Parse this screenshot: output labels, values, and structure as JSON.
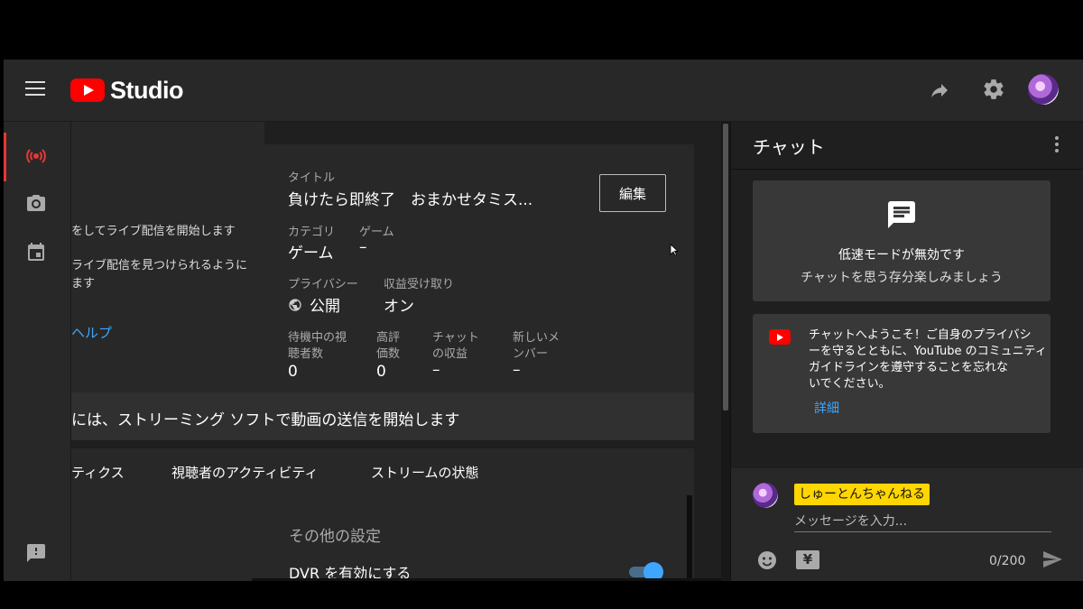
{
  "header": {
    "menu_icon": "hamburger-icon",
    "logo_text": "Studio",
    "share_icon": "share-arrow-icon",
    "settings_icon": "gear-icon"
  },
  "rail": {
    "items": [
      {
        "icon": "live-broadcast-icon",
        "active": true
      },
      {
        "icon": "camera-icon",
        "active": false
      },
      {
        "icon": "calendar-icon",
        "active": false
      },
      {
        "icon": "feedback-icon",
        "active": false
      }
    ],
    "active_color": "#e53935"
  },
  "left_panel": {
    "line1": "をしてライブ配信を開始します",
    "line2": "ライブ配信を見つけられるように",
    "line3": "ます",
    "help_link": "ヘルプ"
  },
  "stream_info": {
    "title_label": "タイトル",
    "title_value": "負けたら即終了　おまかせタミス...",
    "edit_button": "編集",
    "category_label": "カテゴリ",
    "category_value": "ゲーム",
    "game_label": "ゲーム",
    "game_value": "–",
    "privacy_label": "プライバシー",
    "privacy_value": "公開",
    "monetization_label": "収益受け取り",
    "monetization_value": "オン",
    "stats": [
      {
        "label1": "待機中の視",
        "label2": "聴者数",
        "value": "0"
      },
      {
        "label1": "高評",
        "label2": "価数",
        "value": "0"
      },
      {
        "label1": "チャット",
        "label2": "の収益",
        "value": "–"
      },
      {
        "label1": "新しいメ",
        "label2": "ンバー",
        "value": "–"
      }
    ]
  },
  "stream_bar": {
    "text": "には、ストリーミング ソフトで動画の送信を開始します"
  },
  "tabs": {
    "items": [
      "ティクス",
      "視聴者のアクティビティ",
      "ストリームの状態"
    ],
    "settings_title": "その他の設定",
    "dvr_label": "DVR を有効にする",
    "dvr_enabled": true
  },
  "chat": {
    "title": "チャット",
    "slow_mode_title": "低速モードが無効です",
    "slow_mode_sub": "チャットを思う存分楽しみましょう",
    "welcome_lines": [
      "チャットへようこそ！ご自身のプライバシ",
      "ーを守るとともに、YouTube のコミュニティ",
      "ガイドラインを遵守することを忘れな",
      "いでください。"
    ],
    "detail_link": "詳細",
    "user_name": "しゅーとんちゃんねる",
    "input_placeholder": "メッセージを入力...",
    "char_counter": "0/200",
    "accent_color": "#3ea6ff",
    "name_chip_color": "#ffd600"
  }
}
